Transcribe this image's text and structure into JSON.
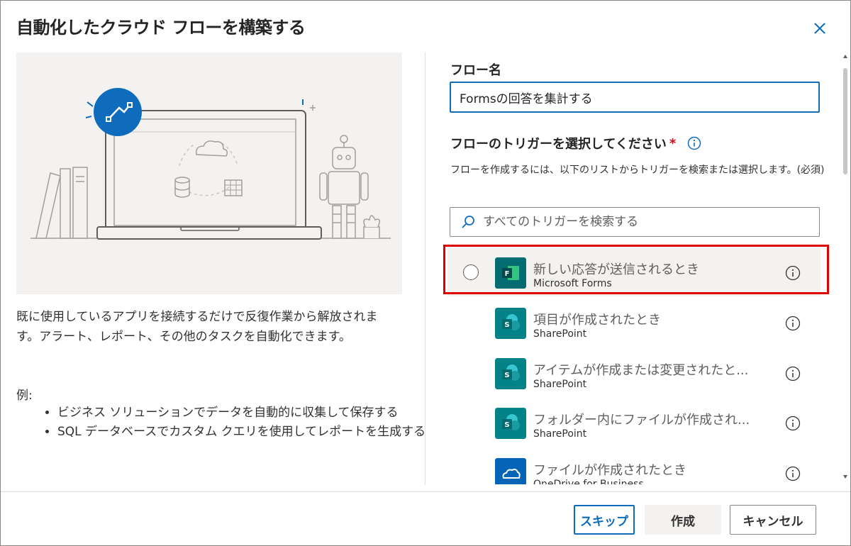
{
  "dialog": {
    "title": "自動化したクラウド フローを構築する",
    "close_icon": "close-icon"
  },
  "left": {
    "description": "既に使用しているアプリを接続するだけで反復作業から解放されます。アラート、レポート、その他のタスクを自動化できます。",
    "example_label": "例:",
    "examples": [
      "ビジネス ソリューションでデータを自動的に収集して保存する",
      "SQL データベースでカスタム クエリを使用してレポートを生成する"
    ]
  },
  "form": {
    "flow_name_label": "フロー名",
    "flow_name_value": "Formsの回答を集計する",
    "trigger_label": "フローのトリガーを選択してください",
    "required_mark": "*",
    "trigger_desc": "フローを作成するには、以下のリストからトリガーを検索または選択します。(必須)",
    "search_placeholder": "すべてのトリガーを検索する"
  },
  "triggers": [
    {
      "title": "新しい応答が送信されるとき",
      "source": "Microsoft Forms",
      "icon": "forms-icon",
      "color": "#036c70"
    },
    {
      "title": "項目が作成されたとき",
      "source": "SharePoint",
      "icon": "sharepoint-icon",
      "color": "#038387"
    },
    {
      "title": "アイテムが作成または変更されたと...",
      "source": "SharePoint",
      "icon": "sharepoint-icon",
      "color": "#038387"
    },
    {
      "title": "フォルダー内にファイルが作成され...",
      "source": "SharePoint",
      "icon": "sharepoint-icon",
      "color": "#038387"
    },
    {
      "title": "ファイルが作成されたとき",
      "source": "OneDrive for Business",
      "icon": "onedrive-icon",
      "color": "#0364b8"
    }
  ],
  "buttons": {
    "skip": "スキップ",
    "create": "作成",
    "cancel": "キャンセル"
  },
  "colors": {
    "accent": "#0f6cbd",
    "highlight": "#e00000"
  }
}
